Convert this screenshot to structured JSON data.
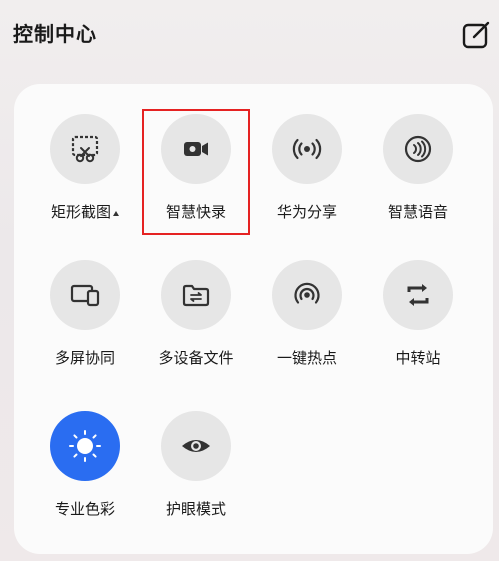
{
  "header": {
    "title": "控制中心"
  },
  "tiles": [
    {
      "label": "矩形截图",
      "icon": "rect-screenshot-icon"
    },
    {
      "label": "智慧快录",
      "icon": "video-record-icon"
    },
    {
      "label": "华为分享",
      "icon": "share-broadcast-icon"
    },
    {
      "label": "智慧语音",
      "icon": "voice-icon"
    },
    {
      "label": "多屏协同",
      "icon": "multi-screen-icon"
    },
    {
      "label": "多设备文件",
      "icon": "folder-transfer-icon"
    },
    {
      "label": "一键热点",
      "icon": "hotspot-icon"
    },
    {
      "label": "中转站",
      "icon": "transfer-station-icon"
    },
    {
      "label": "专业色彩",
      "icon": "pro-color-icon",
      "active": true
    },
    {
      "label": "护眼模式",
      "icon": "eye-icon"
    }
  ],
  "colors": {
    "accent": "#2a6df1",
    "highlight": "#e52222",
    "tile_bg": "#e6e6e6"
  }
}
